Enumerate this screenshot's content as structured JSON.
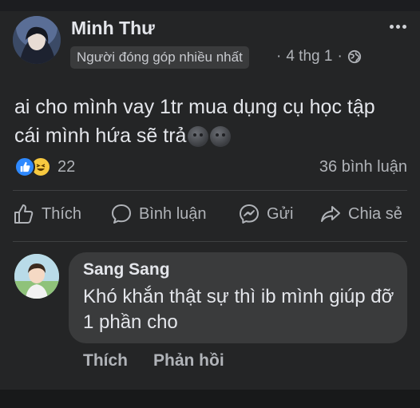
{
  "post": {
    "author": "Minh Thư",
    "badge": "Người đóng góp nhiều nhất",
    "date": "4 thg 1",
    "separator": "·",
    "text_line1": "ai cho mình vay 1tr mua dụng cụ học tập",
    "text_line2": "cái mình hứa sẽ trả",
    "reaction_count": "22",
    "comment_count": "36 bình luận"
  },
  "actions": {
    "like": "Thích",
    "comment": "Bình luận",
    "send": "Gửi",
    "share": "Chia sẻ"
  },
  "comment": {
    "author": "Sang Sang",
    "text": "Khó khắn thật sự thì ib mình giúp đỡ 1 phần cho",
    "like": "Thích",
    "reply": "Phản hồi"
  },
  "colors": {
    "background": "#242526",
    "bubble": "#3a3b3c",
    "like_blue": "#2e89ff",
    "haha_yellow": "#f7c940"
  },
  "icons": [
    "more-icon",
    "globe-icon",
    "like-reaction-icon",
    "haha-reaction-icon",
    "thumb-up-icon",
    "comment-icon",
    "messenger-icon",
    "share-icon",
    "moon-emoji-icon"
  ]
}
